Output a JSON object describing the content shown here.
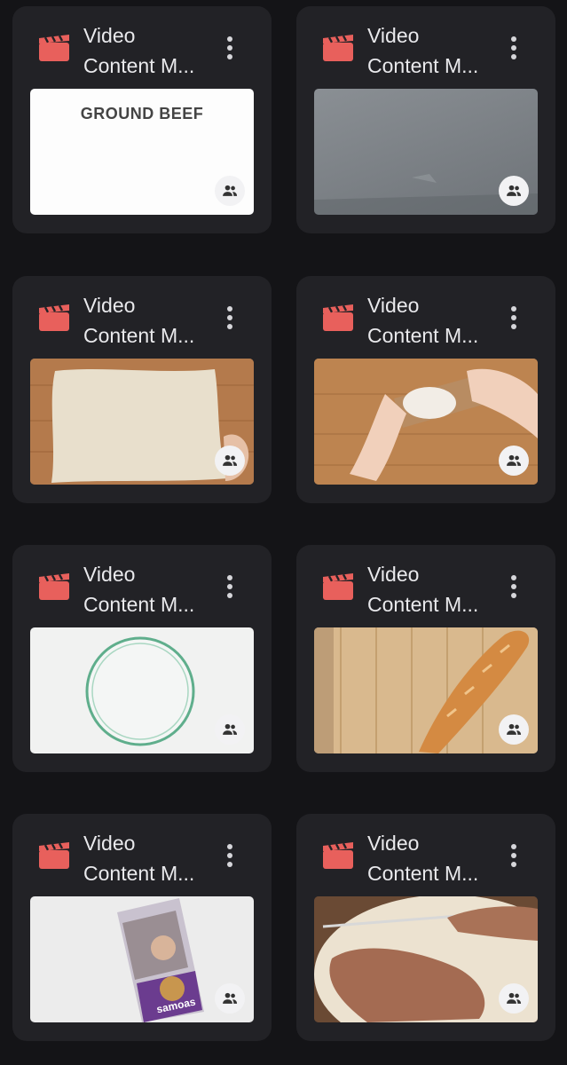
{
  "colors": {
    "background": "#141417",
    "card": "#222226",
    "accent": "#e8605c"
  },
  "cards": [
    {
      "title_line1": "Video",
      "title_line2": "Content M...",
      "thumbnail_text": "GROUND BEEF"
    },
    {
      "title_line1": "Video",
      "title_line2": "Content M..."
    },
    {
      "title_line1": "Video",
      "title_line2": "Content M..."
    },
    {
      "title_line1": "Video",
      "title_line2": "Content M..."
    },
    {
      "title_line1": "Video",
      "title_line2": "Content M..."
    },
    {
      "title_line1": "Video",
      "title_line2": "Content M..."
    },
    {
      "title_line1": "Video",
      "title_line2": "Content M...",
      "thumbnail_text": "samoas"
    },
    {
      "title_line1": "Video",
      "title_line2": "Content M..."
    }
  ],
  "icons": {
    "type_icon": "clapperboard-icon",
    "menu_icon": "more-vert-icon",
    "share_icon": "people-icon"
  }
}
